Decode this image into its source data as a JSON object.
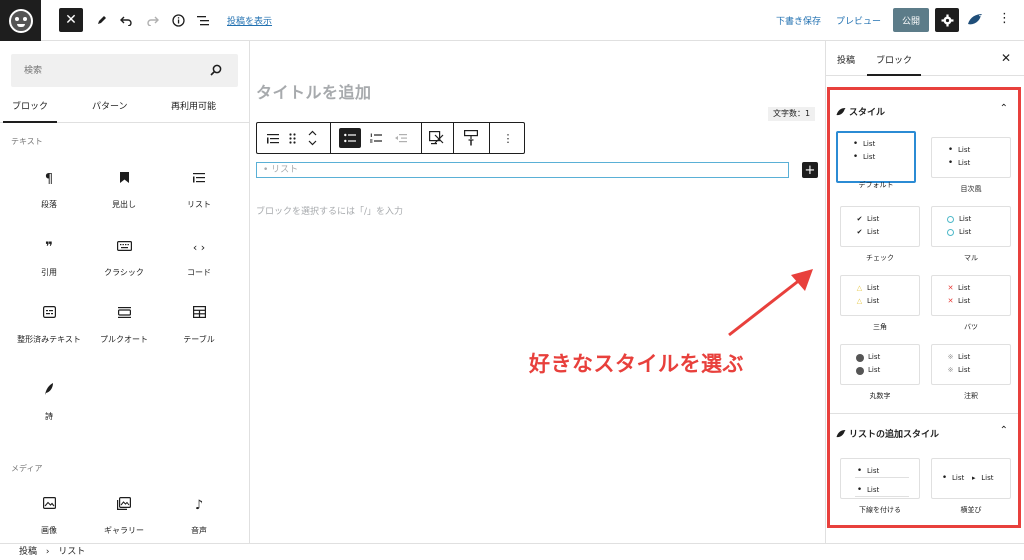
{
  "topbar": {
    "view_post_link": "投稿を表示",
    "save_draft": "下書き保存",
    "preview": "プレビュー",
    "publish": "公開",
    "icons": [
      "close-icon",
      "pencil-icon",
      "undo-icon",
      "redo-icon",
      "info-icon",
      "list-view-icon",
      "settings-gear-icon",
      "bird-logo-icon",
      "kebab-menu-icon"
    ]
  },
  "inserter": {
    "search_placeholder": "検索",
    "tabs": [
      "ブロック",
      "パターン",
      "再利用可能"
    ],
    "categories": {
      "text": "テキスト",
      "media": "メディア"
    },
    "blocks": {
      "paragraph": "段落",
      "heading": "見出し",
      "list": "リスト",
      "quote": "引用",
      "classic": "クラシック",
      "code": "コード",
      "preformatted": "整形済みテキスト",
      "pullquote": "プルクオート",
      "table": "テーブル",
      "verse": "詩",
      "image": "画像",
      "gallery": "ギャラリー",
      "audio": "音声"
    }
  },
  "editor": {
    "title_placeholder": "タイトルを追加",
    "word_count": "文字数：1",
    "list_placeholder": "リスト",
    "empty_block_hint": "ブロックを選択するには「/」を入力",
    "annotation": "好きなスタイルを選ぶ"
  },
  "sidebar": {
    "tabs": [
      "投稿",
      "ブロック"
    ],
    "style_panel": {
      "title": "スタイル",
      "item_text": "List",
      "styles": [
        "デフォルト",
        "目次風",
        "チェック",
        "マル",
        "三角",
        "バツ",
        "丸数字",
        "注釈"
      ]
    },
    "extra_panel": {
      "title": "リストの追加スタイル",
      "styles": [
        "下線を付ける",
        "横並び"
      ]
    }
  },
  "footer": {
    "breadcrumb_root": "投稿",
    "breadcrumb_separator": "›",
    "breadcrumb_current": "リスト"
  },
  "colors": {
    "accent_red": "#e8403c",
    "selection_blue": "#2b8bd4",
    "publish_button": "#5c7c89",
    "link_blue": "#2271b1"
  }
}
